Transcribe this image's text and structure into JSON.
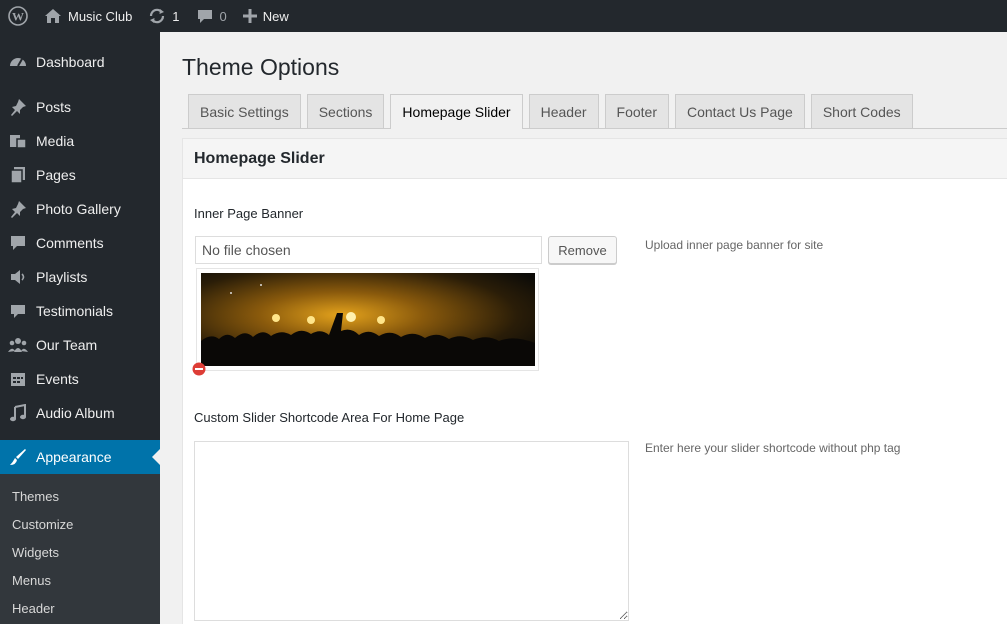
{
  "adminbar": {
    "site_name": "Music Club",
    "updates_count": "1",
    "comments_count": "0",
    "new_label": "New",
    "icons": {
      "wp": "wordpress-logo-icon",
      "home": "home-icon",
      "updates": "refresh-icon",
      "comments": "comment-bubble-icon",
      "new": "plus-icon"
    }
  },
  "sidebar": {
    "items": [
      {
        "label": "Dashboard",
        "icon": "dashboard-icon"
      },
      {
        "label": "Posts",
        "icon": "pin-icon"
      },
      {
        "label": "Media",
        "icon": "media-icon"
      },
      {
        "label": "Pages",
        "icon": "pages-icon"
      },
      {
        "label": "Photo Gallery",
        "icon": "pin-icon"
      },
      {
        "label": "Comments",
        "icon": "comment-icon"
      },
      {
        "label": "Playlists",
        "icon": "speaker-icon"
      },
      {
        "label": "Testimonials",
        "icon": "quote-icon"
      },
      {
        "label": "Our Team",
        "icon": "groups-icon"
      },
      {
        "label": "Events",
        "icon": "calendar-icon"
      },
      {
        "label": "Audio Album",
        "icon": "music-note-icon"
      },
      {
        "label": "Appearance",
        "icon": "paintbrush-icon",
        "current": true
      }
    ],
    "submenu": [
      "Themes",
      "Customize",
      "Widgets",
      "Menus",
      "Header"
    ]
  },
  "page": {
    "title": "Theme Options",
    "tabs": [
      "Basic Settings",
      "Sections",
      "Homepage Slider",
      "Header",
      "Footer",
      "Contact Us Page",
      "Short Codes"
    ],
    "active_tab": "Homepage Slider"
  },
  "panel": {
    "title": "Homepage Slider",
    "banner": {
      "label": "Inner Page Banner",
      "file_value": "No file chosen",
      "remove_label": "Remove",
      "description": "Upload inner page banner for site"
    },
    "shortcode": {
      "label": "Custom Slider Shortcode Area For Home Page",
      "value": "",
      "description": "Enter here your slider shortcode without php tag"
    }
  },
  "colors": {
    "adminbar_bg": "#23282d",
    "sidebar_bg": "#23282d",
    "submenu_bg": "#32373c",
    "accent": "#0073aa",
    "remove_icon": "#dd3d36"
  }
}
